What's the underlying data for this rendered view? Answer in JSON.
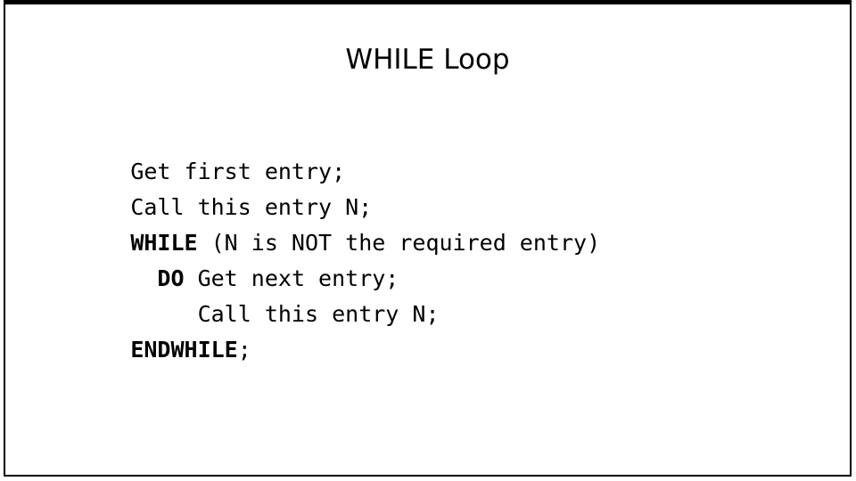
{
  "slide": {
    "title": "WHILE Loop",
    "background_color": "#ffffff",
    "border_color": "#000000",
    "text_color": "#000000",
    "code_lines": [
      {
        "indent": "",
        "keyword": "",
        "rest": "Get first entry;"
      },
      {
        "indent": "",
        "keyword": "",
        "rest": "Call this entry N;"
      },
      {
        "indent": "",
        "keyword": "WHILE",
        "rest": " (N is NOT the required entry)"
      },
      {
        "indent": "  ",
        "keyword": "DO",
        "rest": " Get next entry;"
      },
      {
        "indent": "     ",
        "keyword": "",
        "rest": "Call this entry N;"
      },
      {
        "indent": "",
        "keyword": "ENDWHILE",
        "rest": ";"
      }
    ]
  }
}
